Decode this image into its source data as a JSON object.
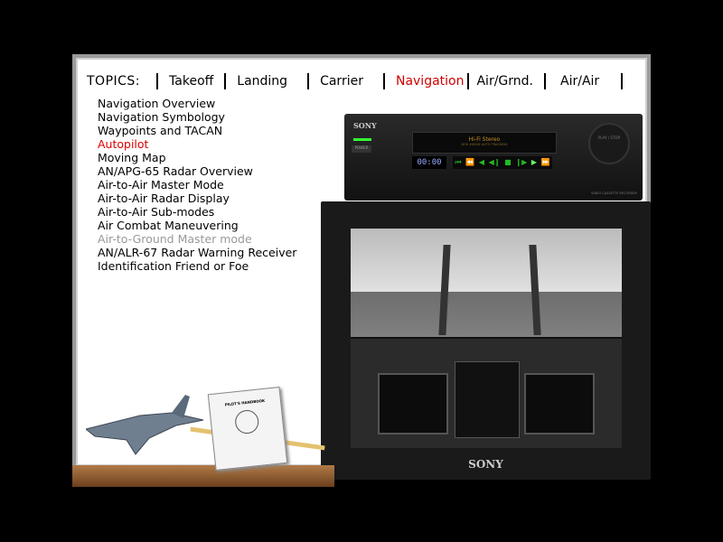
{
  "topics": {
    "label": "TOPICS:",
    "tabs": [
      {
        "label": "Takeoff",
        "active": false
      },
      {
        "label": "Landing",
        "active": false
      },
      {
        "label": "Carrier",
        "active": false
      },
      {
        "label": "Navigation",
        "active": true
      },
      {
        "label": "Air/Grnd.",
        "active": false
      },
      {
        "label": "Air/Air",
        "active": false
      }
    ]
  },
  "lessons": [
    {
      "label": "Navigation Overview",
      "state": "normal"
    },
    {
      "label": "Navigation Symbology",
      "state": "normal"
    },
    {
      "label": "Waypoints and TACAN",
      "state": "normal"
    },
    {
      "label": "Autopilot",
      "state": "active"
    },
    {
      "label": "Moving Map",
      "state": "normal"
    },
    {
      "label": "AN/APG-65 Radar Overview",
      "state": "normal"
    },
    {
      "label": "Air-to-Air Master Mode",
      "state": "normal"
    },
    {
      "label": "Air-to-Air Radar Display",
      "state": "normal"
    },
    {
      "label": "Air-to-Air Sub-modes",
      "state": "normal"
    },
    {
      "label": "Air Combat Maneuvering",
      "state": "normal"
    },
    {
      "label": "Air-to-Ground Master mode",
      "state": "dim"
    },
    {
      "label": "AN/ALR-67 Radar Warning Receiver",
      "state": "normal"
    },
    {
      "label": "Identification Friend or Foe",
      "state": "normal"
    }
  ],
  "vcr": {
    "brand": "SONY",
    "power": "POWER",
    "display_title": "Hi-Fi Stereo",
    "display_sub": "DOS 4HEAD AUTO TRACKING",
    "counter": "00:00",
    "controls": [
      "⏮",
      "⏪",
      "◀",
      "◀❙",
      "■",
      "❙▶",
      "▶",
      "⏩"
    ],
    "dial": "PLAY / STOP",
    "model": "VIDEO CASSETTE RECORDER"
  },
  "tv": {
    "brand": "SONY"
  },
  "book": {
    "title": "PILOT'S HANDBOOK"
  },
  "colors": {
    "active": "#d00000",
    "dim": "#999999"
  }
}
